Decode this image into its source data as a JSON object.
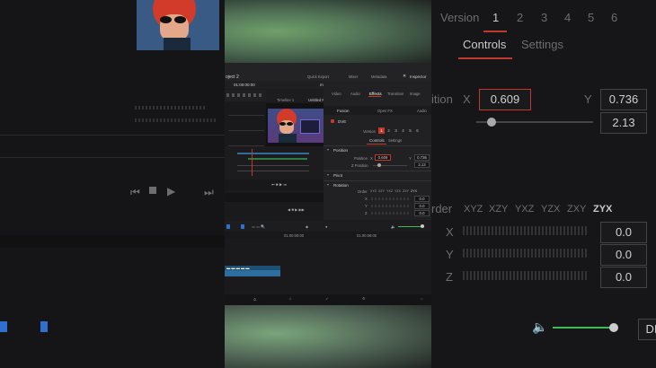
{
  "colors": {
    "accent_red": "#c0392b",
    "timeline_blue": "#2e6e9e",
    "audio_green": "#3dbb5a"
  },
  "bg_right": {
    "version_label": "Version",
    "versions": [
      "1",
      "2",
      "3",
      "4",
      "5",
      "6"
    ],
    "tabs": {
      "controls": "Controls",
      "settings": "Settings"
    },
    "position_label": "ition",
    "x_label": "X",
    "x_value": "0.609",
    "y_label": "Y",
    "y_value": "0.736",
    "z_value": "2.13",
    "order_label": "rder",
    "orders": [
      "XYZ",
      "XZY",
      "YXZ",
      "YZX",
      "ZXY",
      "ZYX"
    ],
    "rot_labels": [
      "X",
      "Y",
      "Z"
    ],
    "rot_values": [
      "0.0",
      "0.0",
      "0.0"
    ],
    "dr_fragment": "DI"
  },
  "header": {
    "project_title": "oject 2",
    "quick_export": "Quick Export",
    "mixer": "Mixer",
    "metadata": "Metadata",
    "inspector": "Inspector",
    "timecode": "01:00:00:00",
    "clip_name": "my character.mov",
    "untitled": "Untitled Pr",
    "timeline_name": "Timeline 1"
  },
  "inspector": {
    "tabs": [
      "Video",
      "Audio",
      "Effects",
      "Transition",
      "Image"
    ],
    "subtabs": {
      "fusion": "Fusion",
      "open_fx": "Open FX",
      "audio": "Audio"
    },
    "dve_label": "DVE",
    "version_label": "Version",
    "versions": [
      "1",
      "2",
      "3",
      "4",
      "5",
      "6"
    ],
    "ctl_tabs": {
      "controls": "Controls",
      "settings": "Settings"
    },
    "position": {
      "title": "Position",
      "pos_label": "Position",
      "x_label": "X",
      "x_value": "0.609",
      "y_label": "Y",
      "y_value": "0.736",
      "z_label": "Z Position",
      "z_value": "2.13"
    },
    "pivot": {
      "title": "Pivot"
    },
    "rotation": {
      "title": "Rotation",
      "order_label": "Order",
      "orders": [
        "XYZ",
        "XZY",
        "YXZ",
        "YZX",
        "ZXY",
        "ZYX"
      ],
      "rows": [
        {
          "axis": "X",
          "value": "0.0"
        },
        {
          "axis": "Y",
          "value": "0.0"
        },
        {
          "axis": "Z",
          "value": "0.0"
        }
      ]
    }
  },
  "timeline": {
    "tc1": "01:00:00:00",
    "tc2": "01:00:08:00"
  }
}
